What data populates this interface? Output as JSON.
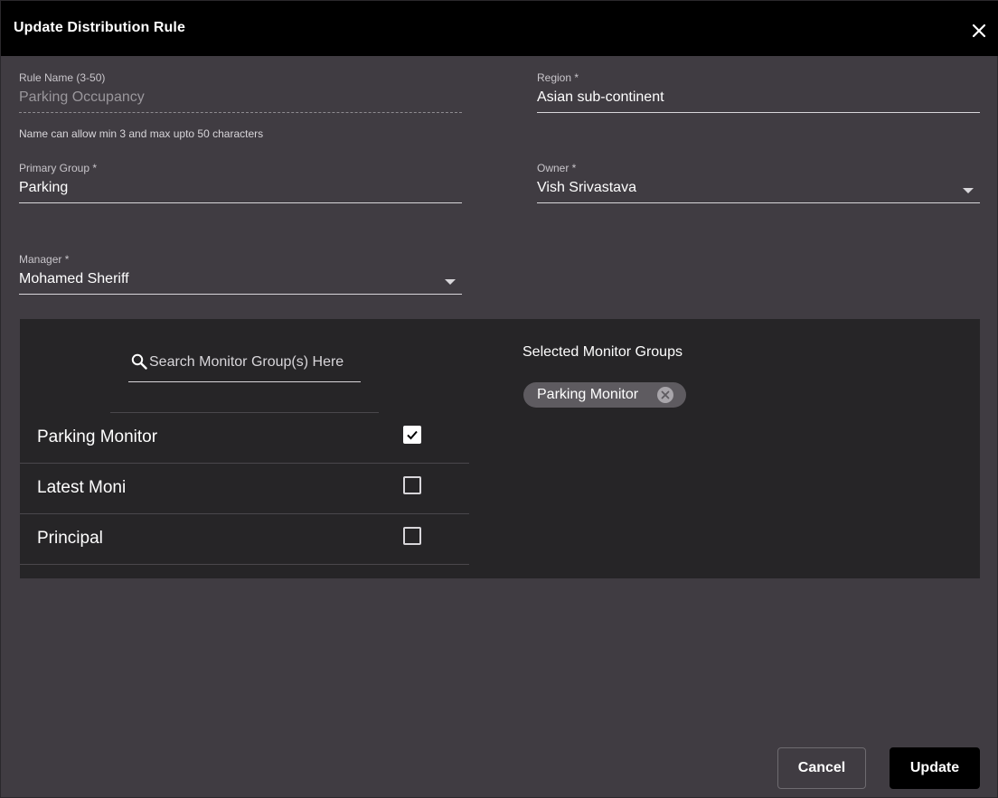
{
  "dialog": {
    "title": "Update Distribution Rule",
    "close_icon": "close-icon"
  },
  "form": {
    "rule_name": {
      "label": "Rule Name (3-50)",
      "value": "Parking Occupancy",
      "hint": "Name can allow min 3 and max upto 50 characters"
    },
    "region": {
      "label": "Region *",
      "value": "Asian sub-continent"
    },
    "primary_group": {
      "label": "Primary Group *",
      "value": "Parking"
    },
    "owner": {
      "label": "Owner *",
      "value": "Vish Srivastava",
      "icon": "dropdown-caret-icon"
    },
    "manager": {
      "label": "Manager *",
      "value": "Mohamed Sheriff",
      "icon": "dropdown-caret-icon"
    }
  },
  "monitor_groups": {
    "search_placeholder": "Search Monitor Group(s) Here",
    "search_icon": "search-icon",
    "items": [
      {
        "label": "Parking Monitor",
        "checked": true
      },
      {
        "label": "Latest Moni",
        "checked": false
      },
      {
        "label": "Principal",
        "checked": false
      }
    ],
    "selected_title": "Selected Monitor Groups",
    "selected": [
      {
        "label": "Parking Monitor",
        "remove_icon": "remove-chip-icon"
      }
    ]
  },
  "actions": {
    "cancel_label": "Cancel",
    "update_label": "Update"
  },
  "colors": {
    "dialog_bg": "#403c42",
    "panel_bg": "#262527",
    "titlebar_bg": "#000000",
    "chip_bg": "#5e5b60",
    "primary_button": "#000000"
  }
}
